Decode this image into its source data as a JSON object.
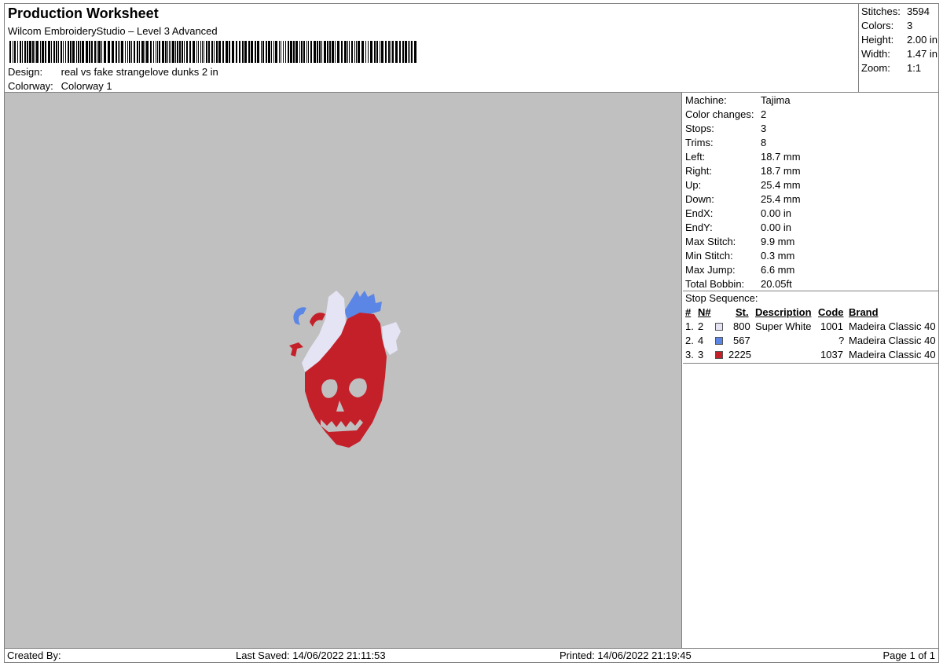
{
  "header": {
    "title": "Production Worksheet",
    "subtitle": "Wilcom EmbroideryStudio – Level 3 Advanced",
    "design_label": "Design:",
    "design_value": "real vs fake strangelove dunks 2 in",
    "colorway_label": "Colorway:",
    "colorway_value": "Colorway 1"
  },
  "summary": [
    {
      "label": "Stitches:",
      "value": "3594"
    },
    {
      "label": "Colors:",
      "value": "3"
    },
    {
      "label": "Height:",
      "value": "2.00 in"
    },
    {
      "label": "Width:",
      "value": "1.47 in"
    },
    {
      "label": "Zoom:",
      "value": "1:1"
    }
  ],
  "machine_info": [
    {
      "label": "Machine:",
      "value": "Tajima"
    },
    {
      "label": "Color changes:",
      "value": "2"
    },
    {
      "label": "Stops:",
      "value": "3"
    },
    {
      "label": "Trims:",
      "value": "8"
    },
    {
      "label": "Left:",
      "value": "18.7 mm"
    },
    {
      "label": "Right:",
      "value": "18.7 mm"
    },
    {
      "label": "Up:",
      "value": "25.4 mm"
    },
    {
      "label": "Down:",
      "value": "25.4 mm"
    },
    {
      "label": "EndX:",
      "value": "0.00 in"
    },
    {
      "label": "EndY:",
      "value": "0.00 in"
    },
    {
      "label": "Max Stitch:",
      "value": "9.9 mm"
    },
    {
      "label": "Min Stitch:",
      "value": "0.3 mm"
    },
    {
      "label": "Max Jump:",
      "value": "6.6 mm"
    },
    {
      "label": "Total Bobbin:",
      "value": "20.05ft"
    }
  ],
  "stop_sequence": {
    "title": "Stop Sequence:",
    "headers": {
      "num": "#",
      "needle": "N#",
      "stitches": "St.",
      "description": "Description",
      "code": "Code",
      "brand": "Brand"
    },
    "rows": [
      {
        "num": "1.",
        "needle": "2",
        "color": "#e4e4f4",
        "stitches": "800",
        "description": "Super White",
        "code": "1001",
        "brand": "Madeira Classic 40"
      },
      {
        "num": "2.",
        "needle": "4",
        "color": "#5b86e5",
        "stitches": "567",
        "description": "",
        "code": "?",
        "brand": "Madeira Classic 40"
      },
      {
        "num": "3.",
        "needle": "3",
        "color": "#c4202a",
        "stitches": "2225",
        "description": "",
        "code": "1037",
        "brand": "Madeira Classic 40"
      }
    ]
  },
  "footer": {
    "created_by": "Created By:",
    "last_saved": "Last Saved: 14/06/2022 21:11:53",
    "printed": "Printed: 14/06/2022 21:19:45",
    "page": "Page 1 of 1"
  }
}
